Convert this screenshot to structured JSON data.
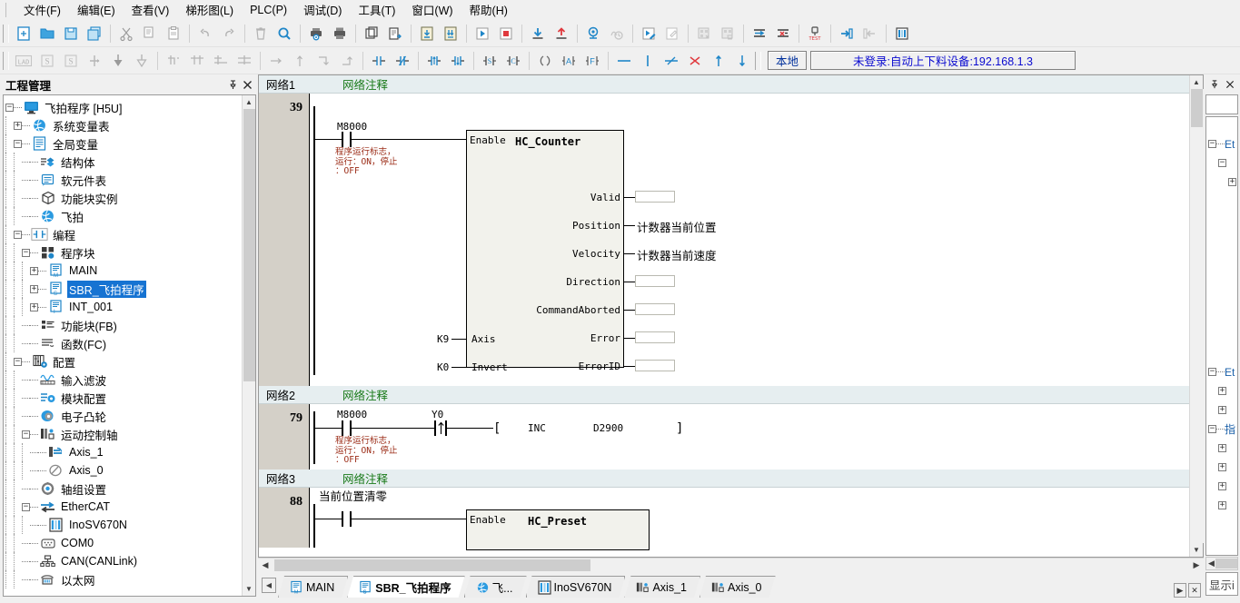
{
  "menu": {
    "items": [
      {
        "label": "文件(F)",
        "name": "menu-file"
      },
      {
        "label": "编辑(E)",
        "name": "menu-edit"
      },
      {
        "label": "查看(V)",
        "name": "menu-view"
      },
      {
        "label": "梯形图(L)",
        "name": "menu-ladder"
      },
      {
        "label": "PLC(P)",
        "name": "menu-plc"
      },
      {
        "label": "调试(D)",
        "name": "menu-debug"
      },
      {
        "label": "工具(T)",
        "name": "menu-tools"
      },
      {
        "label": "窗口(W)",
        "name": "menu-window"
      },
      {
        "label": "帮助(H)",
        "name": "menu-help"
      }
    ]
  },
  "toolbar_main": {
    "icons": [
      "new-file-icon",
      "open-folder-icon",
      "save-icon",
      "save-all-icon",
      "cut-icon",
      "copy-icon",
      "paste-icon",
      "undo-icon",
      "redo-icon",
      "delete-icon",
      "search-icon",
      "print-preview-icon",
      "print-icon",
      "compile-icon",
      "compile-all-icon",
      "download-doc-icon",
      "upload-doc-icon",
      "run-icon",
      "stop-icon",
      "download-plc-icon",
      "upload-plc-icon",
      "monitor-icon",
      "clock-monitor-icon",
      "run-edit-icon",
      "edit-mode-icon",
      "clear-program-icon",
      "clear-data-icon",
      "insert-row-icon",
      "delete-row-icon",
      "test-device-icon",
      "login-icon",
      "logout-icon",
      "module-view-icon"
    ]
  },
  "toolbar_ladder": {
    "icons": [
      "lad-mode-icon",
      "stl-mode-icon",
      "sfc-mode-icon",
      "insert-vertical-icon",
      "insert-below-icon",
      "insert-above-icon",
      "branch-tr-icon",
      "branch-tt-icon",
      "branch-bl-icon",
      "branch-bt-icon",
      "arrow-right-icon",
      "arrow-up-icon",
      "corner-down-icon",
      "corner-up-icon",
      "contact-no-icon",
      "contact-nc-icon",
      "contact-rising-icon",
      "contact-falling-icon",
      "set-coil-icon",
      "reset-coil-icon",
      "coil-icon",
      "func-block-a-icon",
      "func-f-icon",
      "hline-icon",
      "vline-icon",
      "del-hline-icon",
      "del-vline-icon",
      "move-up-icon",
      "move-down-icon"
    ],
    "local_label": "本地",
    "login_status": "未登录:自动上下料设备:192.168.1.3"
  },
  "project_panel": {
    "title": "工程管理",
    "pin_icon": "pin-icon",
    "close_icon": "close-icon",
    "tree": [
      {
        "label": "飞拍程序 [H5U]",
        "depth": 0,
        "expander": "minus",
        "icon": "monitor-icon",
        "selected": false
      },
      {
        "label": "系统变量表",
        "depth": 1,
        "expander": "plus",
        "icon": "globe-icon",
        "selected": false
      },
      {
        "label": "全局变量",
        "depth": 1,
        "expander": "minus",
        "icon": "list-icon",
        "selected": false
      },
      {
        "label": "结构体",
        "depth": 2,
        "expander": "none",
        "icon": "struct-icon",
        "selected": false
      },
      {
        "label": "软元件表",
        "depth": 2,
        "expander": "none",
        "icon": "table-icon",
        "selected": false
      },
      {
        "label": "功能块实例",
        "depth": 2,
        "expander": "none",
        "icon": "cube-icon",
        "selected": false
      },
      {
        "label": "飞拍",
        "depth": 2,
        "expander": "none",
        "icon": "globe-icon",
        "selected": false
      },
      {
        "label": "编程",
        "depth": 1,
        "expander": "minus",
        "icon": "contact-icon",
        "selected": false
      },
      {
        "label": "程序块",
        "depth": 2,
        "expander": "minus",
        "icon": "blocks-icon",
        "selected": false
      },
      {
        "label": "MAIN",
        "depth": 3,
        "expander": "plus",
        "icon": "pou-main-icon",
        "selected": false
      },
      {
        "label": "SBR_飞拍程序",
        "depth": 3,
        "expander": "plus",
        "icon": "pou-sbr-icon",
        "selected": true
      },
      {
        "label": "INT_001",
        "depth": 3,
        "expander": "plus",
        "icon": "pou-int-icon",
        "selected": false
      },
      {
        "label": "功能块(FB)",
        "depth": 2,
        "expander": "none",
        "icon": "fb-icon",
        "selected": false
      },
      {
        "label": "函数(FC)",
        "depth": 2,
        "expander": "none",
        "icon": "fc-icon",
        "selected": false
      },
      {
        "label": "配置",
        "depth": 1,
        "expander": "minus",
        "icon": "config-icon",
        "selected": false
      },
      {
        "label": "输入滤波",
        "depth": 2,
        "expander": "none",
        "icon": "filter-icon",
        "selected": false
      },
      {
        "label": "模块配置",
        "depth": 2,
        "expander": "none",
        "icon": "module-config-icon",
        "selected": false
      },
      {
        "label": "电子凸轮",
        "depth": 2,
        "expander": "none",
        "icon": "cam-icon",
        "selected": false
      },
      {
        "label": "运动控制轴",
        "depth": 2,
        "expander": "minus",
        "icon": "axes-icon",
        "selected": false
      },
      {
        "label": "Axis_1",
        "depth": 3,
        "expander": "none",
        "icon": "axis-active-icon",
        "selected": false
      },
      {
        "label": "Axis_0",
        "depth": 3,
        "expander": "none",
        "icon": "axis-icon",
        "selected": false
      },
      {
        "label": "轴组设置",
        "depth": 2,
        "expander": "none",
        "icon": "gear-icon",
        "selected": false
      },
      {
        "label": "EtherCAT",
        "depth": 2,
        "expander": "minus",
        "icon": "ethercat-icon",
        "selected": false
      },
      {
        "label": "InoSV670N",
        "depth": 3,
        "expander": "none",
        "icon": "servo-icon",
        "selected": false
      },
      {
        "label": "COM0",
        "depth": 2,
        "expander": "none",
        "icon": "serial-port-icon",
        "selected": false
      },
      {
        "label": "CAN(CANLink)",
        "depth": 2,
        "expander": "none",
        "icon": "can-icon",
        "selected": false
      },
      {
        "label": "以太网",
        "depth": 2,
        "expander": "none",
        "icon": "ethernet-icon",
        "selected": false
      }
    ]
  },
  "ladder": {
    "networks": [
      {
        "name": "网络1",
        "comment": "网络注释",
        "rung_number": "39",
        "contact": {
          "label": "M8000",
          "comment": "程序运行标志，\n运行：ON，停止\n：OFF"
        },
        "block": {
          "title": "HC_Counter",
          "enable_label": "Enable",
          "inputs": [
            {
              "pin": "Axis",
              "value": "K9"
            },
            {
              "pin": "Invert",
              "value": "K0"
            }
          ],
          "outputs": [
            {
              "pin": "Valid",
              "value": "",
              "kind": "box"
            },
            {
              "pin": "Position",
              "value": "计数器当前位置",
              "kind": "text"
            },
            {
              "pin": "Velocity",
              "value": "计数器当前速度",
              "kind": "text"
            },
            {
              "pin": "Direction",
              "value": "",
              "kind": "box"
            },
            {
              "pin": "CommandAborted",
              "value": "",
              "kind": "box"
            },
            {
              "pin": "Error",
              "value": "",
              "kind": "box"
            },
            {
              "pin": "ErrorID",
              "value": "",
              "kind": "box"
            }
          ]
        }
      },
      {
        "name": "网络2",
        "comment": "网络注释",
        "rung_number": "79",
        "contact": {
          "label": "M8000",
          "comment": "程序运行标志，\n运行：ON，停止\n：OFF"
        },
        "contact2": {
          "label": "Y0",
          "type": "rising-edge"
        },
        "instruction": {
          "op": "INC",
          "operand": "D2900"
        }
      },
      {
        "name": "网络3",
        "comment": "网络注释",
        "rung_number": "88",
        "contact": {
          "label": "当前位置清零"
        },
        "block": {
          "title": "HC_Preset",
          "enable_label": "Enable"
        }
      }
    ]
  },
  "tabs": {
    "nav_prev_icon": "chevron-left-icon",
    "nav_next_icon": "chevron-right-icon",
    "close_icon": "close-icon",
    "items": [
      {
        "label": "MAIN",
        "icon": "pou-main-icon",
        "active": false
      },
      {
        "label": "SBR_飞拍程序",
        "icon": "pou-sbr-icon",
        "active": true
      },
      {
        "label": "飞...",
        "icon": "globe-icon",
        "active": false
      },
      {
        "label": "InoSV670N",
        "icon": "servo-icon",
        "active": false
      },
      {
        "label": "Axis_1",
        "icon": "axes-icon",
        "active": false
      },
      {
        "label": "Axis_0",
        "icon": "axes-icon",
        "active": false
      }
    ]
  },
  "right_panel": {
    "pin_icon": "pin-icon",
    "close_icon": "close-icon",
    "nodes": [
      {
        "label": "Et",
        "depth": 0,
        "expander": "minus"
      },
      {
        "label": "",
        "depth": 1,
        "expander": "minus"
      },
      {
        "label": "",
        "depth": 2,
        "expander": "plus"
      },
      {
        "label": "Et",
        "depth": 0,
        "expander": "minus"
      },
      {
        "label": "",
        "depth": 1,
        "expander": "plus"
      },
      {
        "label": "",
        "depth": 1,
        "expander": "plus"
      },
      {
        "label": "指",
        "depth": 0,
        "expander": "minus"
      },
      {
        "label": "",
        "depth": 1,
        "expander": "plus"
      },
      {
        "label": "",
        "depth": 1,
        "expander": "plus"
      },
      {
        "label": "",
        "depth": 1,
        "expander": "plus"
      },
      {
        "label": "",
        "depth": 1,
        "expander": "plus"
      }
    ],
    "footer_label": "显示i"
  },
  "colors": {
    "accent": "#1f86c8",
    "comment_green": "#1a7a1a",
    "comment_red": "#9b2b16",
    "selection_blue": "#1673d2",
    "net_header_bg": "#e6eef0",
    "gutter_bg": "#d4d0c8",
    "fb_bg": "#f2f2ec",
    "status_blue": "#0a0ad0"
  }
}
